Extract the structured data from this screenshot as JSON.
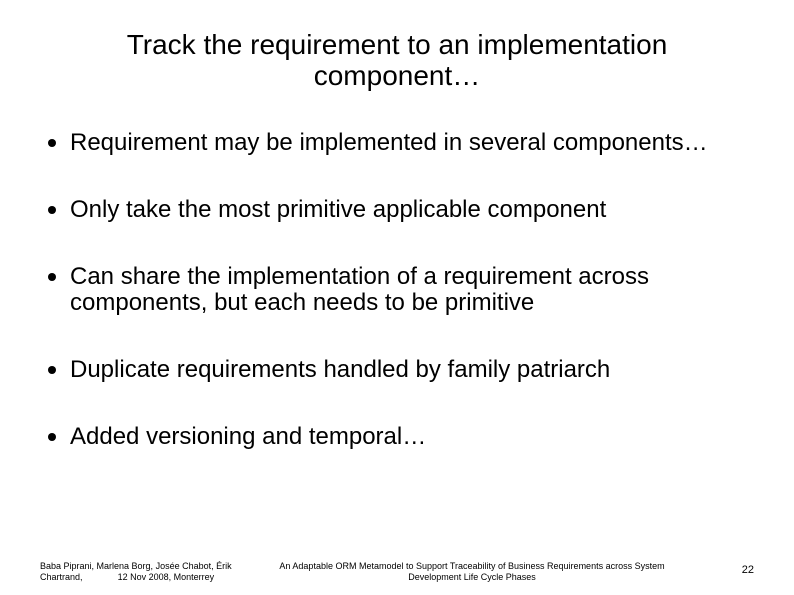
{
  "title": "Track the requirement to an implementation component…",
  "bullets": [
    "Requirement may be implemented in several components…",
    "Only take the most primitive applicable component",
    "Can share the implementation of a requirement across components, but each needs to be primitive",
    "Duplicate requirements handled by family patriarch",
    "Added versioning and temporal…"
  ],
  "footer": {
    "authors": "Baba Piprani, Marlena Borg, Josée Chabot, Érik Chartrand,",
    "date_place": "12 Nov 2008, Monterrey",
    "center": "An Adaptable ORM Metamodel to Support Traceability of Business Requirements across System Development Life Cycle Phases",
    "page": "22"
  }
}
